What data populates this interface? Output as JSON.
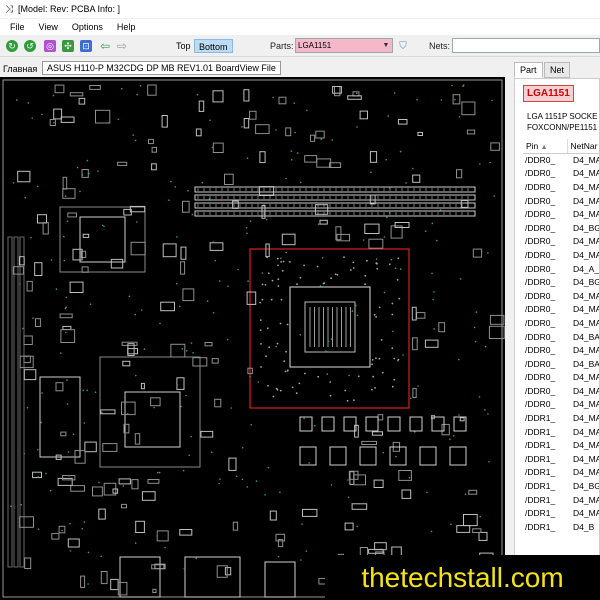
{
  "window": {
    "title": "[Model: Rev:  PCBA Info: ]",
    "icon": "crossed-arrows-icon"
  },
  "menu": {
    "items": [
      "File",
      "View",
      "Options",
      "Help"
    ]
  },
  "toolbar": {
    "icons": [
      {
        "name": "refresh-green-icon",
        "color": "#2e9d3a"
      },
      {
        "name": "refresh-green-2-icon",
        "color": "#2e9d3a"
      },
      {
        "name": "zoom-icon",
        "color": "#b04fd0"
      },
      {
        "name": "fit-icon",
        "color": "#3a9a40"
      },
      {
        "name": "select-icon",
        "color": "#3a6fd0"
      },
      {
        "name": "back-arrow-icon",
        "color": "#3aa048"
      },
      {
        "name": "forward-arrow-icon",
        "color": "#9a9a9a"
      }
    ],
    "top_label": "Top",
    "bottom_label": "Bottom",
    "parts_label": "Parts:",
    "parts_value": "LGA1151",
    "nets_label": "Nets:",
    "nets_value": ""
  },
  "left": {
    "home_label": "Главная",
    "board_tab": "ASUS H110-P M32CDG DP MB REV1.01 BoardView File"
  },
  "right_panel": {
    "tabs": [
      "Part",
      "Net"
    ],
    "part_name": "LGA1151",
    "description_lines": [
      "LGA 1151P SOCKE",
      "FOXCONN/PE1151"
    ],
    "table": {
      "headers": [
        "Pin",
        "NetNar"
      ],
      "rows": [
        {
          "pin": "/DDR0_",
          "net": "D4_MA"
        },
        {
          "pin": "/DDR0_",
          "net": "D4_MA"
        },
        {
          "pin": "/DDR0_",
          "net": "D4_MA"
        },
        {
          "pin": "/DDR0_",
          "net": "D4_MA"
        },
        {
          "pin": "/DDR0_",
          "net": "D4_MA"
        },
        {
          "pin": "/DDR0_",
          "net": "D4_BG"
        },
        {
          "pin": "/DDR0_",
          "net": "D4_MA"
        },
        {
          "pin": "/DDR0_",
          "net": "D4_MA"
        },
        {
          "pin": "/DDR0_",
          "net": "D4_A_"
        },
        {
          "pin": "/DDR0_",
          "net": "D4_BG"
        },
        {
          "pin": "/DDR0_",
          "net": "D4_MA"
        },
        {
          "pin": "/DDR0_",
          "net": "D4_MA"
        },
        {
          "pin": "/DDR0_",
          "net": "D4_MA"
        },
        {
          "pin": "/DDR0_",
          "net": "D4_BA"
        },
        {
          "pin": "/DDR0_",
          "net": "D4_MA"
        },
        {
          "pin": "/DDR0_",
          "net": "D4_BA"
        },
        {
          "pin": "/DDR0_",
          "net": "D4_MA"
        },
        {
          "pin": "/DDR0_",
          "net": "D4_MA"
        },
        {
          "pin": "/DDR0_",
          "net": "D4_MA"
        },
        {
          "pin": "/DDR1_",
          "net": "D4_MA"
        },
        {
          "pin": "/DDR1_",
          "net": "D4_MA"
        },
        {
          "pin": "/DDR1_",
          "net": "D4_MA"
        },
        {
          "pin": "/DDR1_",
          "net": "D4_MA"
        },
        {
          "pin": "/DDR1_",
          "net": "D4_MA"
        },
        {
          "pin": "/DDR1_",
          "net": "D4_BG"
        },
        {
          "pin": "/DDR1_",
          "net": "D4_MA"
        },
        {
          "pin": "/DDR1_",
          "net": "D4_MA"
        },
        {
          "pin": "/DDR1_",
          "net": "D4_B"
        }
      ]
    }
  },
  "watermark": "thetechstall.com",
  "colors": {
    "board_bg": "#000000",
    "component_outline": "#d8d8d8",
    "selection_box": "#d42020",
    "parts_highlight": "#f4b8c8",
    "toolbar_active": "#bcdcf4",
    "watermark_text": "#f4e21a"
  }
}
